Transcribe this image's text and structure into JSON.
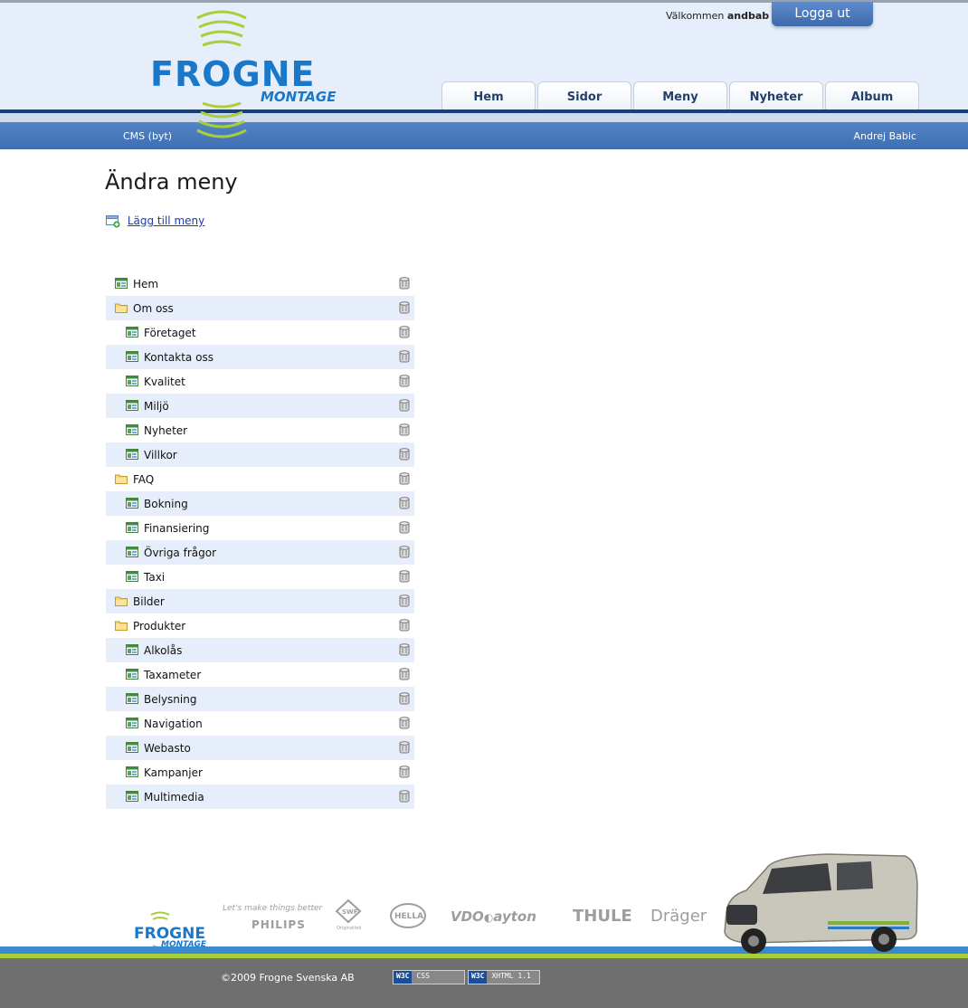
{
  "header": {
    "logo_main": "FRONGE",
    "logo_sub": "MONTAGE",
    "welcome_prefix": "Välkommen",
    "username": "andbab",
    "logout_label": "Logga ut",
    "tabs": [
      {
        "label": "Hem"
      },
      {
        "label": "Sidor"
      },
      {
        "label": "Meny"
      },
      {
        "label": "Nyheter"
      },
      {
        "label": "Album"
      }
    ],
    "cms_link": "CMS (byt)",
    "user_fullname": "Andrej Babic"
  },
  "main": {
    "title": "Ändra meny",
    "add_link": "Lägg till meny",
    "items": [
      {
        "label": "Hem",
        "type": "page",
        "level": 0
      },
      {
        "label": "Om oss",
        "type": "folder",
        "level": 0
      },
      {
        "label": "Företaget",
        "type": "page",
        "level": 1
      },
      {
        "label": "Kontakta oss",
        "type": "page",
        "level": 1
      },
      {
        "label": "Kvalitet",
        "type": "page",
        "level": 1
      },
      {
        "label": "Miljö",
        "type": "page",
        "level": 1
      },
      {
        "label": "Nyheter",
        "type": "page",
        "level": 1
      },
      {
        "label": "Villkor",
        "type": "page",
        "level": 1
      },
      {
        "label": "FAQ",
        "type": "folder",
        "level": 0
      },
      {
        "label": "Bokning",
        "type": "page",
        "level": 1
      },
      {
        "label": "Finansiering",
        "type": "page",
        "level": 1
      },
      {
        "label": "Övriga frågor",
        "type": "page",
        "level": 1
      },
      {
        "label": "Taxi",
        "type": "page",
        "level": 1
      },
      {
        "label": "Bilder",
        "type": "folder",
        "level": 0
      },
      {
        "label": "Produkter",
        "type": "folder",
        "level": 0
      },
      {
        "label": "Alkolås",
        "type": "page",
        "level": 1
      },
      {
        "label": "Taxameter",
        "type": "page",
        "level": 1
      },
      {
        "label": "Belysning",
        "type": "page",
        "level": 1
      },
      {
        "label": "Navigation",
        "type": "page",
        "level": 1
      },
      {
        "label": "Webasto",
        "type": "page",
        "level": 1
      },
      {
        "label": "Kampanjer",
        "type": "page",
        "level": 1
      },
      {
        "label": "Multimedia",
        "type": "page",
        "level": 1
      }
    ]
  },
  "footer": {
    "logo_main": "FROGNE",
    "logo_sub": "MONTAGE",
    "brands": {
      "philips_tagline": "Let's make things better",
      "philips": "PHILIPS",
      "swf": "SWF",
      "swf_sub": "Originalteil",
      "hella": "HELLA",
      "vdo": "VDO",
      "dayton": "ayton",
      "thule": "THULE",
      "drager": "Dräger"
    },
    "copyright": "©2009 Frogne Svenska AB",
    "badge_css_w3": "W3C",
    "badge_css": "CSS",
    "badge_xhtml_w3": "W3C",
    "badge_xhtml": "XHTML 1.1"
  }
}
